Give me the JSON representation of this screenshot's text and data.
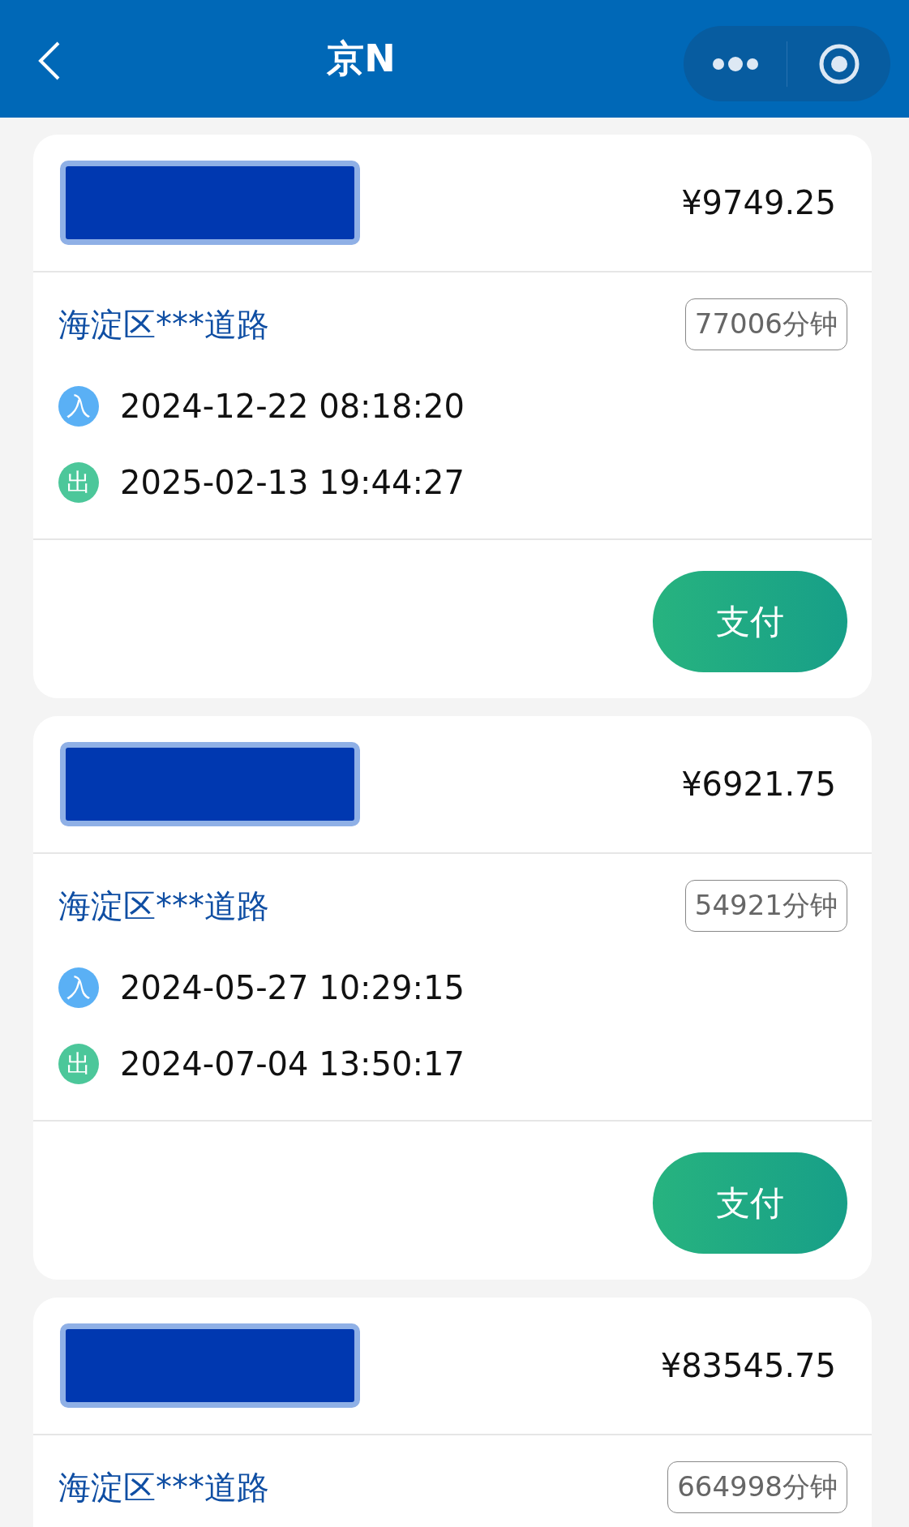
{
  "nav_bar": {
    "title": "京N"
  },
  "records": [
    {
      "amount": "¥9749.25",
      "location": "海淀区***道路",
      "duration": "77006分钟",
      "times": [
        {
          "kind": "entry",
          "badge": "入",
          "time": "2024-12-22 08:18:20"
        },
        {
          "kind": "exit",
          "badge": "出",
          "time": "2025-02-13 19:44:27"
        }
      ],
      "button": "支付"
    },
    {
      "amount": "¥6921.75",
      "location": "海淀区***道路",
      "duration": "54921分钟",
      "times": [
        {
          "kind": "entry",
          "badge": "入",
          "time": "2024-05-27 10:29:15"
        },
        {
          "kind": "exit",
          "badge": "出",
          "time": "2024-07-04 13:50:17"
        }
      ],
      "button": "支付"
    },
    {
      "amount": "¥83545.75",
      "location": "海淀区***道路",
      "duration": "664998分钟"
    }
  ]
}
